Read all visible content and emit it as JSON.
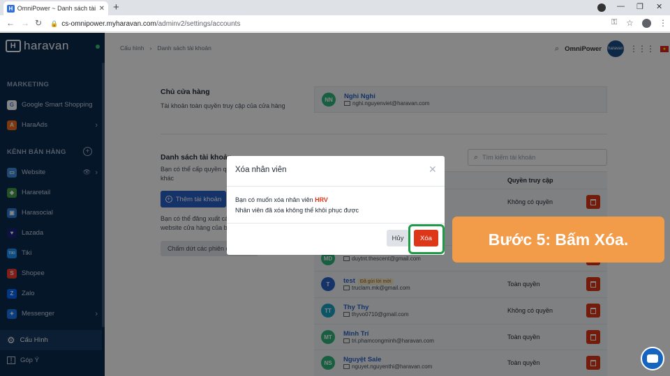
{
  "browser": {
    "tab_title": "OmniPower ~ Danh sách tài khoản",
    "url_host": "cs-omnipower.myharavan.com",
    "url_path": "/adminv2/settings/accounts",
    "favicon_letter": "H"
  },
  "sidebar": {
    "logo_text": "haravan",
    "logo_mark": "H",
    "marketing_heading": "MARKETING",
    "marketing_items": [
      {
        "label": "Google Smart Shopping",
        "icon": "google-icon",
        "color": "#ffffff",
        "glyph": "G"
      },
      {
        "label": "HaraAds",
        "icon": "haraads-icon",
        "color": "#f26b1d",
        "glyph": "A"
      }
    ],
    "channels_heading": "KÊNH BÁN HÀNG",
    "channel_items": [
      {
        "label": "Website",
        "icon": "website-icon",
        "color": "#3c8ddc",
        "glyph": "▭"
      },
      {
        "label": "Hararetail",
        "icon": "hararetail-icon",
        "color": "#43a047",
        "glyph": "◆"
      },
      {
        "label": "Harasocial",
        "icon": "harasocial-icon",
        "color": "#2e7bd6",
        "glyph": "▣"
      },
      {
        "label": "Lazada",
        "icon": "lazada-icon",
        "color": "#1a237e",
        "glyph": "♥"
      },
      {
        "label": "Tiki",
        "icon": "tiki-icon",
        "color": "#1a94ff",
        "glyph": "TIKI"
      },
      {
        "label": "Shopee",
        "icon": "shopee-icon",
        "color": "#f53d2d",
        "glyph": "S"
      },
      {
        "label": "Zalo",
        "icon": "zalo-icon",
        "color": "#0068ff",
        "glyph": "Z"
      },
      {
        "label": "Messenger",
        "icon": "messenger-icon",
        "color": "#1877f2",
        "glyph": "✦"
      }
    ],
    "settings_label": "Cấu Hình",
    "feedback_label": "Góp Ý"
  },
  "header": {
    "breadcrumb": [
      "Cấu hình",
      "Danh sách tài khoản"
    ],
    "shop_name": "OmniPower",
    "avatar_text": "haravan"
  },
  "owner": {
    "title": "Chủ cửa hàng",
    "description": "Tài khoản toàn quyền truy cập của cửa hàng",
    "initials": "NN",
    "name": "Nghi Nghi",
    "email": "nghi.nguyenviet@haravan.com",
    "color": "#2eb67d"
  },
  "accounts": {
    "title": "Danh sách tài khoản",
    "description_line1": "Bạn có thể cấp quyền qu",
    "description_line2": "khác",
    "add_button": "Thêm tài khoản",
    "logout_line1": "Bạn có thể đăng xuất cá",
    "logout_line2": "website cửa hàng của bạ",
    "end_sessions_button": "Chấm dứt các phiên đ",
    "search_placeholder": "Tìm kiếm tài khoản",
    "col_access": "Quyền truy cập",
    "rows": [
      {
        "initials": "",
        "name": "",
        "email": "",
        "access": "Không có quyền",
        "color": "#2eb67d",
        "badge": ""
      },
      {
        "initials": "MD",
        "name": "",
        "email": "duytnt.thescent@gmail.com",
        "access": "",
        "color": "#2eb67d",
        "badge": ""
      },
      {
        "initials": "T",
        "name": "test",
        "email": "truclam.mk@gmail.com",
        "access": "Toàn quyền",
        "color": "#2962c8",
        "badge": "Đã gửi lời mời"
      },
      {
        "initials": "TT",
        "name": "Thy Thy",
        "email": "thyvo0710@gmail.com",
        "access": "Không có quyền",
        "color": "#1aa3c4",
        "badge": ""
      },
      {
        "initials": "MT",
        "name": "Minh Trí",
        "email": "tri.phamcongminh@haravan.com",
        "access": "Toàn quyền",
        "color": "#2eb67d",
        "badge": ""
      },
      {
        "initials": "NS",
        "name": "Nguyệt Sale",
        "email": "nguyet.nguyenthi@haravan.com",
        "access": "Toàn quyền",
        "color": "#2eb67d",
        "badge": ""
      }
    ]
  },
  "modal": {
    "title": "Xóa nhân viên",
    "body_prefix": "Bạn có muốn xóa nhân viên ",
    "employee": "HRV",
    "body_line2": "Nhân viên đã xóa không thể khôi phục được",
    "cancel": "Hủy",
    "confirm": "Xóa"
  },
  "callout": "Bước 5: Bấm Xóa."
}
